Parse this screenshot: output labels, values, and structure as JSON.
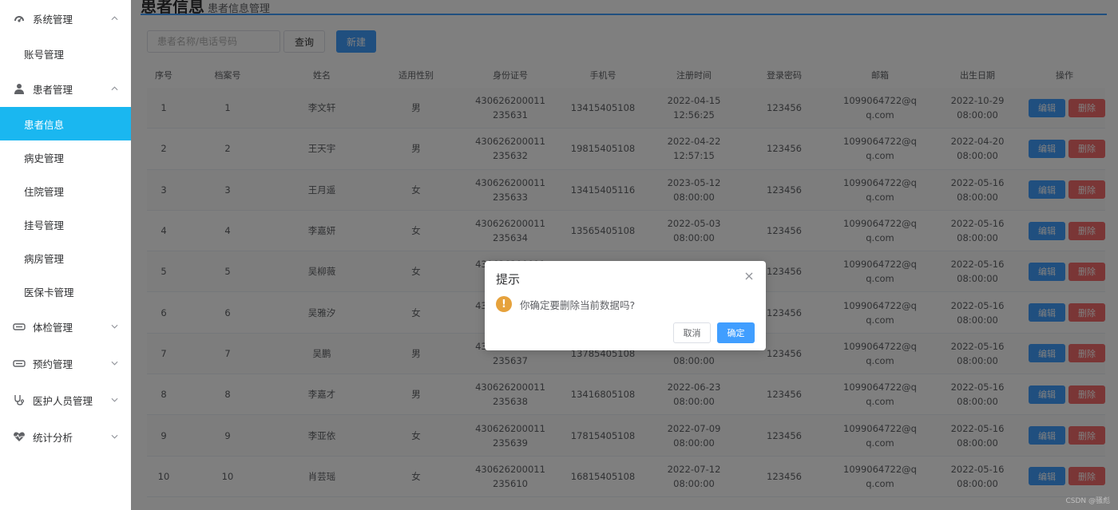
{
  "sidebar": {
    "system_group": "系统管理",
    "system_items": [
      "账号管理"
    ],
    "patient_group": "患者管理",
    "patient_items": [
      "患者信息",
      "病史管理",
      "住院管理",
      "挂号管理",
      "病房管理",
      "医保卡管理"
    ],
    "active_item": "患者信息",
    "other_groups": [
      "体检管理",
      "预约管理",
      "医护人员管理",
      "统计分析"
    ]
  },
  "page": {
    "title": "患者信息",
    "subtitle": "患者信息管理"
  },
  "toolbar": {
    "search_placeholder": "患者名称/电话号码",
    "query_label": "查询",
    "new_label": "新建"
  },
  "table": {
    "headers": [
      "序号",
      "档案号",
      "姓名",
      "适用性别",
      "身份证号",
      "手机号",
      "注册时间",
      "登录密码",
      "邮箱",
      "出生日期",
      "操作"
    ],
    "edit_label": "编辑",
    "delete_label": "删除",
    "rows": [
      {
        "no": "1",
        "file": "1",
        "name": "李文轩",
        "gender": "男",
        "id": "430626200011235631",
        "phone": "13415405108",
        "reg": "2022-04-15 12:56:25",
        "pwd": "123456",
        "email": "1099064722@qq.com",
        "birth": "2022-10-29 08:00:00"
      },
      {
        "no": "2",
        "file": "2",
        "name": "王天宇",
        "gender": "男",
        "id": "430626200011235632",
        "phone": "19815405108",
        "reg": "2022-04-22 12:57:15",
        "pwd": "123456",
        "email": "1099064722@qq.com",
        "birth": "2022-04-20 08:00:00"
      },
      {
        "no": "3",
        "file": "3",
        "name": "王月遥",
        "gender": "女",
        "id": "430626200011235633",
        "phone": "13415405116",
        "reg": "2023-05-12 08:00:00",
        "pwd": "123456",
        "email": "1099064722@qq.com",
        "birth": "2022-05-16 08:00:00"
      },
      {
        "no": "4",
        "file": "4",
        "name": "李嘉妍",
        "gender": "女",
        "id": "430626200011235634",
        "phone": "13565405108",
        "reg": "2022-05-03 08:00:00",
        "pwd": "123456",
        "email": "1099064722@qq.com",
        "birth": "2022-05-16 08:00:00"
      },
      {
        "no": "5",
        "file": "5",
        "name": "吴柳薇",
        "gender": "女",
        "id": "430626200011235635",
        "phone": "",
        "reg": "",
        "pwd": "123456",
        "email": "1099064722@qq.com",
        "birth": "2022-05-16 08:00:00"
      },
      {
        "no": "6",
        "file": "6",
        "name": "吴雅汐",
        "gender": "女",
        "id": "430626200011235636",
        "phone": "",
        "reg": "",
        "pwd": "123456",
        "email": "1099064722@qq.com",
        "birth": "2022-05-16 08:00:00"
      },
      {
        "no": "7",
        "file": "7",
        "name": "吴鹏",
        "gender": "男",
        "id": "430626200011235637",
        "phone": "13785405108",
        "reg": "2022-06-15 08:00:00",
        "pwd": "123456",
        "email": "1099064722@qq.com",
        "birth": "2022-05-16 08:00:00"
      },
      {
        "no": "8",
        "file": "8",
        "name": "李嘉才",
        "gender": "男",
        "id": "430626200011235638",
        "phone": "13416805108",
        "reg": "2022-06-23 08:00:00",
        "pwd": "123456",
        "email": "1099064722@qq.com",
        "birth": "2022-05-16 08:00:00"
      },
      {
        "no": "9",
        "file": "9",
        "name": "李亚依",
        "gender": "女",
        "id": "430626200011235639",
        "phone": "17815405108",
        "reg": "2022-07-09 08:00:00",
        "pwd": "123456",
        "email": "1099064722@qq.com",
        "birth": "2022-05-16 08:00:00"
      },
      {
        "no": "10",
        "file": "10",
        "name": "肖芸瑶",
        "gender": "女",
        "id": "430626200011235610",
        "phone": "16815405108",
        "reg": "2022-07-12 08:00:00",
        "pwd": "123456",
        "email": "1099064722@qq.com",
        "birth": "2022-05-16 08:00:00"
      }
    ]
  },
  "dialog": {
    "title": "提示",
    "message": "你确定要删除当前数据吗?",
    "cancel_label": "取消",
    "confirm_label": "确定"
  },
  "watermark": "CSDN @骚彪",
  "colors": {
    "primary": "#409eff",
    "danger": "#f56c6c",
    "warning": "#e6a23c",
    "active_menu": "#1ab7f0"
  }
}
